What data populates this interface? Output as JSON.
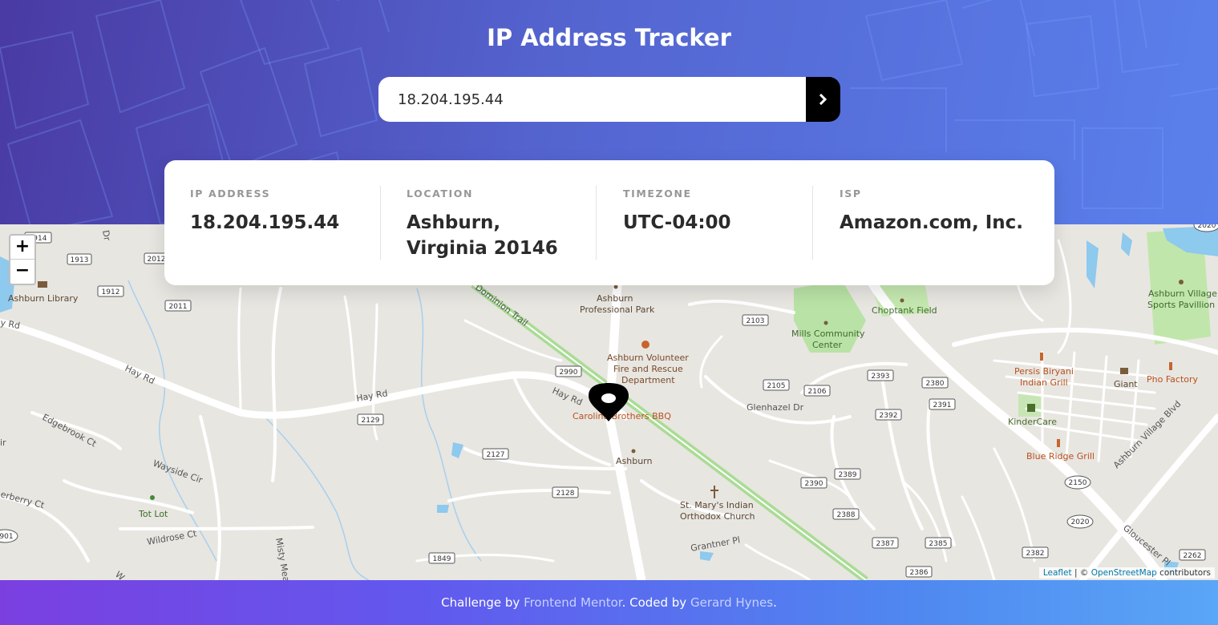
{
  "app": {
    "title": "IP Address Tracker"
  },
  "search": {
    "value": "18.204.195.44"
  },
  "info": [
    {
      "label": "IP ADDRESS",
      "value": "18.204.195.44"
    },
    {
      "label": "LOCATION",
      "value": "Ashburn, Virginia 20146"
    },
    {
      "label": "TIMEZONE",
      "value": "UTC-04:00"
    },
    {
      "label": "ISP",
      "value": "Amazon.com, Inc."
    }
  ],
  "map": {
    "zoom_in": "+",
    "zoom_out": "−",
    "labels": {
      "ashburn_library": "Ashburn Library",
      "ashburn_professional_park_1": "Ashburn",
      "ashburn_professional_park_2": "Professional Park",
      "volunteer_fire_1": "Ashburn Volunteer",
      "volunteer_fire_2": "Fire and Rescue",
      "volunteer_fire_3": "Department",
      "mills_1": "Mills Community",
      "mills_2": "Center",
      "choptank": "Choptank Field",
      "sports_1": "Ashburn Village",
      "sports_2": "Sports Pavillion",
      "persis_1": "Persis Biryani",
      "persis_2": "Indian Grill",
      "giant": "Giant",
      "pho": "Pho Factory",
      "kindercare": "KinderCare",
      "blue_ridge": "Blue Ridge Grill",
      "carolina": "Carolina Brothers BBQ",
      "ashburn": "Ashburn",
      "st_marys_1": "St. Mary's Indian",
      "st_marys_2": "Orthodox Church",
      "tot_lot": "Tot Lot",
      "hay_rd_1": "Hay Rd",
      "hay_rd_2": "Hay Rd",
      "hay_rd_3": "Hay Rd",
      "hay_rd_4": "y Rd",
      "edgebrook": "Edgebrook Ct",
      "wayside": "Wayside Cir",
      "wildrose": "Wildrose Ct",
      "berry": "erberry Ct",
      "glenhazel": "Glenhazel Dr",
      "grantner": "Grantner Pl",
      "misty": "Misty Mead",
      "dominion": "Dominion Trail",
      "ashburn_village_blvd": "Ashburn Village Blvd",
      "gloucester": "Gloucester Pl",
      "dr_frag": "Dr",
      "ir_frag": "ir",
      "w_frag": "W"
    },
    "shields": [
      "1914",
      "1913",
      "2012",
      "1912",
      "2011",
      "2990",
      "2129",
      "2127",
      "2128",
      "1849",
      "2103",
      "2105",
      "2106",
      "2393",
      "2380",
      "2391",
      "2392",
      "2390",
      "2389",
      "2388",
      "2387",
      "2385",
      "2386",
      "2382",
      "2150",
      "2020",
      "2262",
      "2020",
      "901"
    ],
    "attribution": {
      "leaflet": "Leaflet",
      "sep": " | © ",
      "osm": "OpenStreetMap",
      "contrib": " contributors"
    }
  },
  "footer": {
    "prefix": "Challenge by ",
    "fm": "Frontend Mentor",
    "middle": ". Coded by ",
    "author": "Gerard Hynes",
    "suffix": "."
  }
}
